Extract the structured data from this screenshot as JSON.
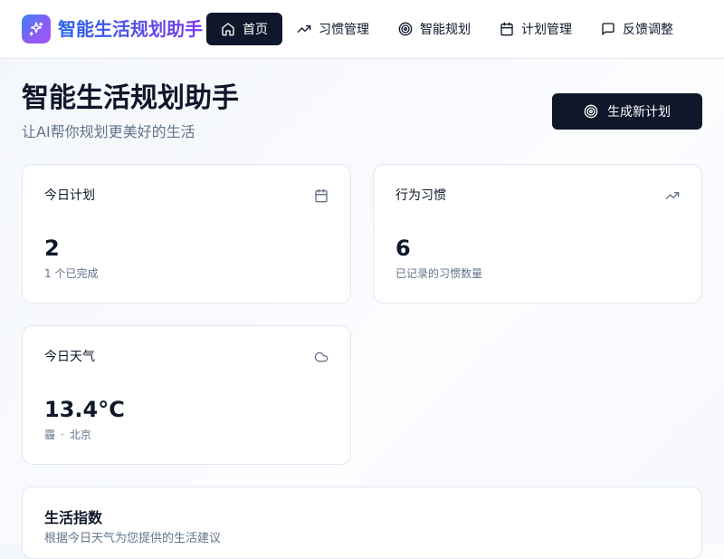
{
  "app": {
    "brand": "智能生活规划助手",
    "logo_icon": "sparkles-icon",
    "colors": {
      "brand_start": "#3b82f6",
      "brand_end": "#8b5cf6",
      "primary": "#0f172a"
    }
  },
  "nav": {
    "items": [
      {
        "label": "首页",
        "icon": "home-icon",
        "active": true
      },
      {
        "label": "习惯管理",
        "icon": "trending-up-icon"
      },
      {
        "label": "智能规划",
        "icon": "target-icon"
      },
      {
        "label": "计划管理",
        "icon": "calendar-icon"
      },
      {
        "label": "反馈调整",
        "icon": "message-square-icon"
      }
    ]
  },
  "page": {
    "title": "智能生活规划助手",
    "subtitle": "让AI帮你规划更美好的生活",
    "primary_button": {
      "label": "生成新计划",
      "icon": "target-icon"
    }
  },
  "cards": {
    "today_plan": {
      "title": "今日计划",
      "icon": "calendar-icon",
      "value": "2",
      "desc": "1 个已完成"
    },
    "habits": {
      "title": "行为习惯",
      "icon": "trending-up-icon",
      "value": "6",
      "desc": "已记录的习惯数量"
    },
    "weather": {
      "title": "今日天气",
      "icon": "cloud-icon",
      "value": "13.4°C",
      "condition": "霾",
      "separator": "·",
      "city": "北京"
    }
  },
  "life_index": {
    "title": "生活指数",
    "desc": "根据今日天气为您提供的生活建议"
  }
}
